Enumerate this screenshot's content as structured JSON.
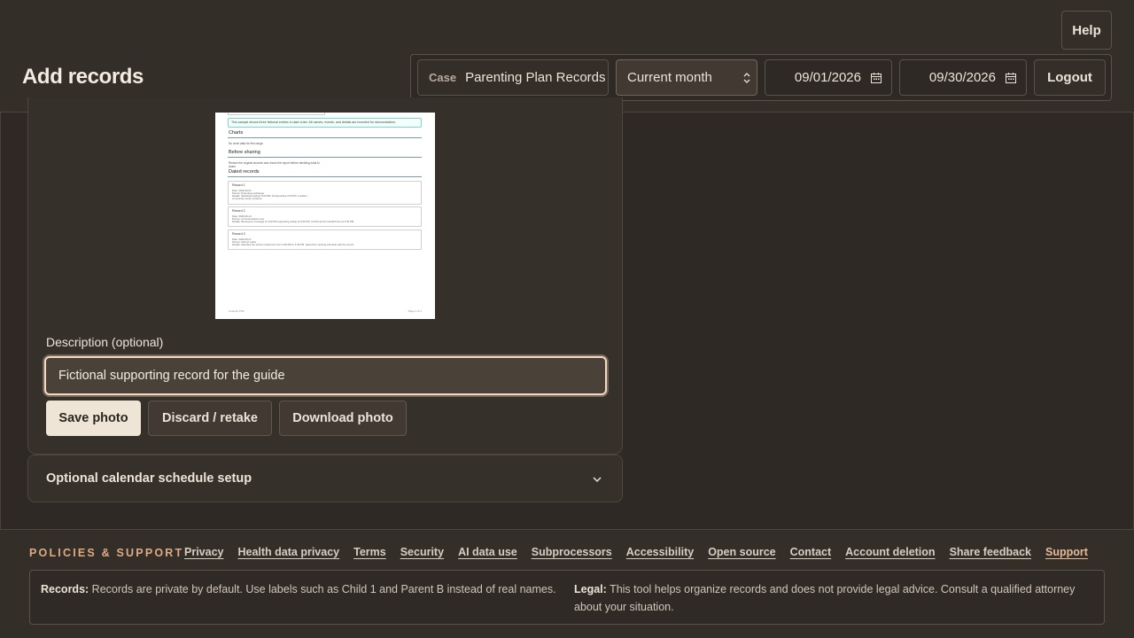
{
  "header": {
    "help_label": "Help",
    "page_title": "Add records",
    "case_label": "Case",
    "case_value": "Parenting Plan Records",
    "range_value": "Current month",
    "start_date": "09/01/2026",
    "end_date": "09/30/2026",
    "logout_label": "Logout"
  },
  "preview": {
    "note": "This sample shows three fictional entries in date order. All names, events, and details are invented for demonstration.",
    "charts_heading": "Charts",
    "charts_text": "No chart data for this range.",
    "before_heading": "Before sharing",
    "before_text": "Review the original sources and check the report before deciding what to",
    "before_text2": "share.",
    "records_heading": "Dated records",
    "records": [
      {
        "title": "Record 1",
        "lines": [
          "Date: 2026-09-01",
          "Person: Parenting exchanger",
          "Details: Scheduled pickup 3:00 PM. Actual pickup 3:15 PM. Location:",
          "community center entrance."
        ]
      },
      {
        "title": "Record 2",
        "lines": [
          "Date: 2026-09-14",
          "Person: Communication note",
          "Details: Received a message at 4:00 PM requesting pickup at 6:00 PM. Confirmed the handoff time at 4:30 PM."
        ]
      },
      {
        "title": "Record 3",
        "lines": [
          "Date: 2026-09-27",
          "Person: School notice",
          "Details: Attended the school conference from 3:00 PM to 3:45 PM. Saved the meeting schedule with the record."
        ]
      }
    ],
    "footer_left": "Custody Print",
    "footer_right": "Page 1 of 1"
  },
  "form": {
    "description_label": "Description (optional)",
    "description_value": "Fictional supporting record for the guide",
    "save_label": "Save photo",
    "discard_label": "Discard / retake",
    "download_label": "Download photo"
  },
  "accordion": {
    "label": "Optional calendar schedule setup"
  },
  "footer": {
    "title": "POLICIES & SUPPORT",
    "links": [
      "Privacy",
      "Health data privacy",
      "Terms",
      "Security",
      "AI data use",
      "Subprocessors",
      "Accessibility",
      "Open source",
      "Contact",
      "Account deletion",
      "Share feedback",
      "Support"
    ],
    "records_label": "Records:",
    "records_text": "Records are private by default. Use labels such as Child 1 and Parent B instead of real names.",
    "legal_label": "Legal:",
    "legal_text": "This tool helps organize records and does not provide legal advice. Consult a qualified attorney about your situation."
  },
  "colors": {
    "background": "#2e2924",
    "accent": "#e0a985",
    "primary_button": "#efe5d6"
  }
}
